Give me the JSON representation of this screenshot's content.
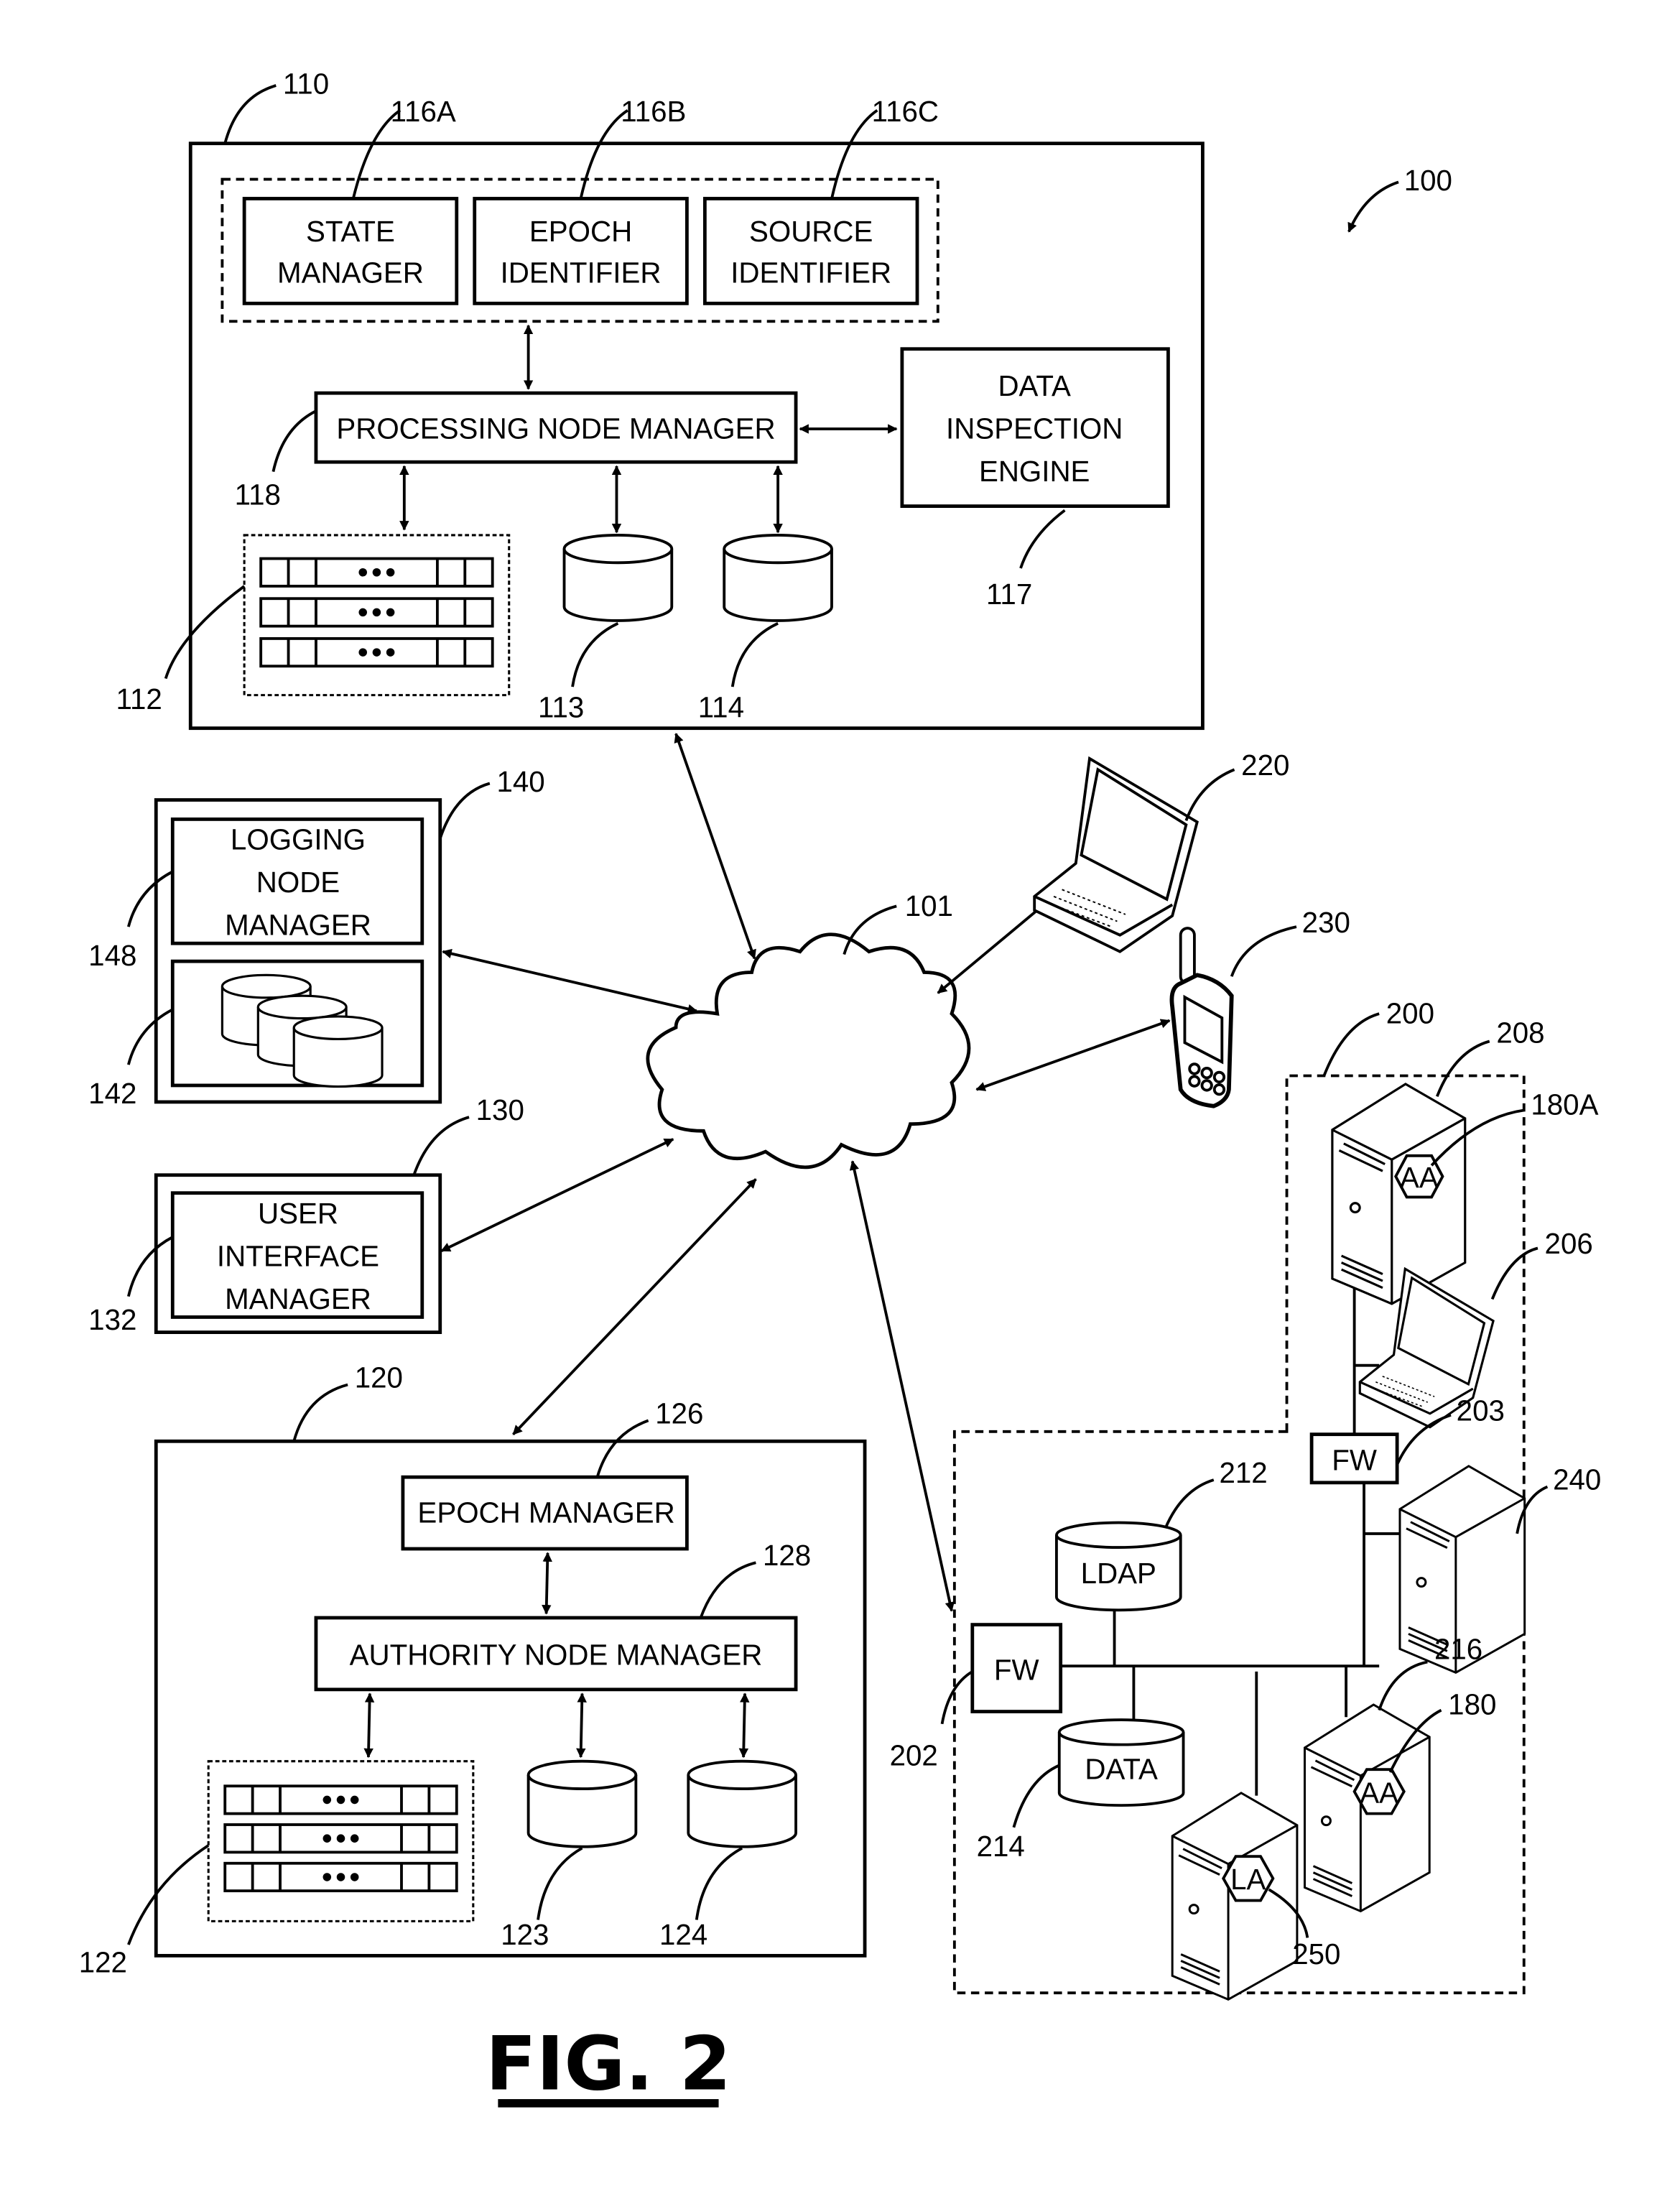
{
  "figure": {
    "title": "FIG. 2",
    "system_ref": "100"
  },
  "processing_node": {
    "ref": "110",
    "state_manager": {
      "ref": "116A",
      "line1": "STATE",
      "line2": "MANAGER"
    },
    "epoch_identifier": {
      "ref": "116B",
      "line1": "EPOCH",
      "line2": "IDENTIFIER"
    },
    "source_identifier": {
      "ref": "116C",
      "line1": "SOURCE",
      "line2": "IDENTIFIER"
    },
    "manager": {
      "ref": "118",
      "label": "PROCESSING NODE MANAGER"
    },
    "inspection_engine": {
      "ref": "117",
      "line1": "DATA",
      "line2": "INSPECTION",
      "line3": "ENGINE"
    },
    "servers_ref": "112",
    "db1_ref": "113",
    "db2_ref": "114"
  },
  "network": {
    "ref": "101"
  },
  "logging_node": {
    "ref": "140",
    "manager": {
      "ref": "148",
      "line1": "LOGGING",
      "line2": "NODE",
      "line3": "MANAGER"
    },
    "storage_ref": "142"
  },
  "ui_node": {
    "ref": "130",
    "manager": {
      "ref": "132",
      "line1": "USER",
      "line2": "INTERFACE",
      "line3": "MANAGER"
    }
  },
  "authority_node": {
    "ref": "120",
    "epoch_manager": {
      "ref": "126",
      "label": "EPOCH MANAGER"
    },
    "manager": {
      "ref": "128",
      "label": "AUTHORITY NODE MANAGER"
    },
    "servers_ref": "122",
    "db1_ref": "123",
    "db2_ref": "124"
  },
  "clients": {
    "laptop_ref": "220",
    "phone_ref": "230"
  },
  "enterprise": {
    "ref": "200",
    "server_top": {
      "ref": "208",
      "agent_ref": "180A",
      "agent_label": "AA"
    },
    "laptop_ref": "206",
    "firewall_inner": {
      "ref": "203",
      "label": "FW"
    },
    "server_240_ref": "240",
    "ldap": {
      "ref": "212",
      "label": "LDAP"
    },
    "firewall_outer": {
      "ref": "202",
      "label": "FW"
    },
    "data_store": {
      "ref": "214",
      "label": "DATA"
    },
    "server_216": {
      "ref": "216",
      "agent_ref": "180",
      "agent_label": "AA"
    },
    "server_250": {
      "ref": "250",
      "agent_label": "LA"
    }
  }
}
